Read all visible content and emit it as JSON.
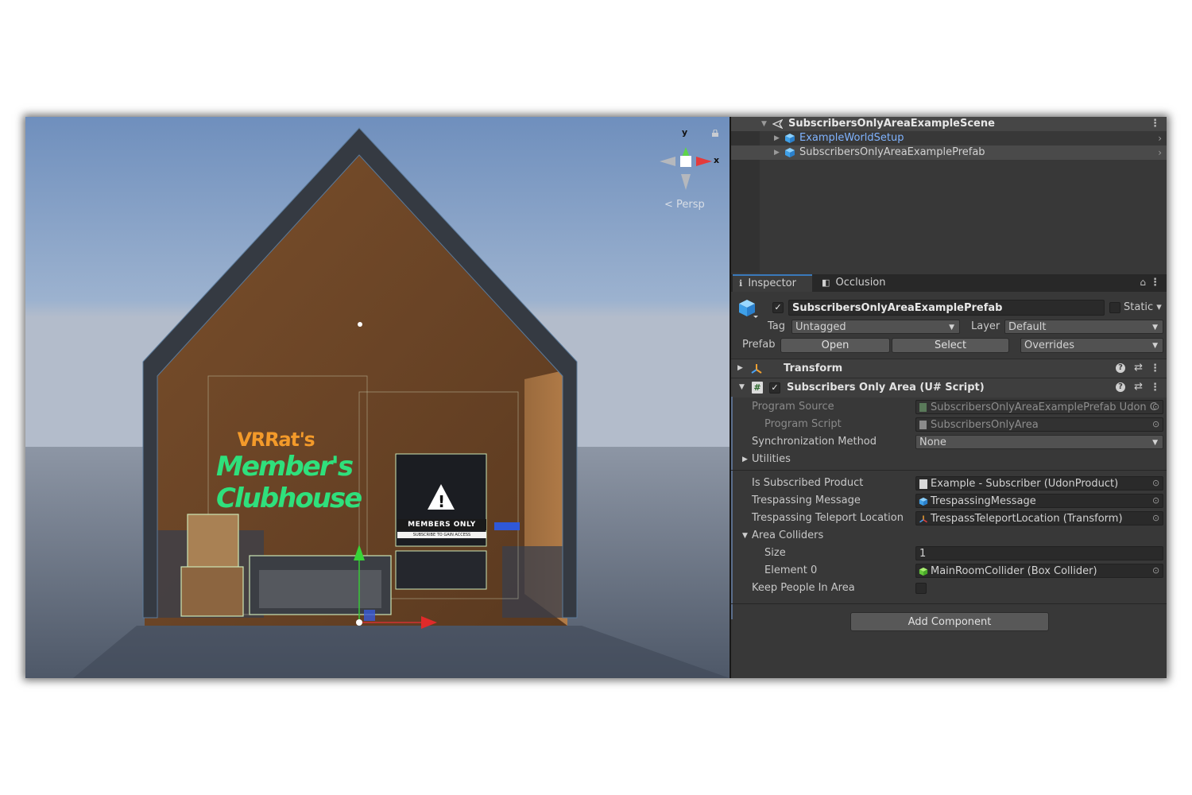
{
  "scene_view": {
    "persp_label": "Persp",
    "axis_y": "y",
    "axis_x": "x",
    "sign": {
      "line1": "VRRat's",
      "line2": "Member's",
      "line3": "Clubhouse"
    },
    "board": {
      "banner": "MEMBERS ONLY",
      "subtitle": "SUBSCRIBE TO GAIN ACCESS"
    },
    "colors": {
      "sky": "#7e9cc4",
      "ground": "#5d6677",
      "wall": "#6b4425",
      "frame": "#353a42",
      "neon_green": "#2fe07c",
      "orange": "#f39a2a"
    }
  },
  "hierarchy": {
    "scene_name": "SubscribersOnlyAreaExampleScene",
    "items": [
      {
        "label": "ExampleWorldSetup",
        "color": "#7fb3ff"
      },
      {
        "label": "SubscribersOnlyAreaExamplePrefab",
        "color": "#d2d2d2"
      }
    ]
  },
  "tabs": {
    "inspector": "Inspector",
    "occlusion": "Occlusion"
  },
  "inspector": {
    "object_name": "SubscribersOnlyAreaExamplePrefab",
    "static_label": "Static",
    "tag_label": "Tag",
    "tag_value": "Untagged",
    "layer_label": "Layer",
    "layer_value": "Default",
    "prefab_label": "Prefab",
    "open_button": "Open",
    "select_button": "Select",
    "overrides_label": "Overrides",
    "transform_title": "Transform",
    "script_title": "Subscribers Only Area (U# Script)",
    "fields": {
      "program_source_label": "Program Source",
      "program_source_value": "SubscribersOnlyAreaExamplePrefab Udon C",
      "program_script_label": "Program Script",
      "program_script_value": "SubscribersOnlyArea",
      "sync_label": "Synchronization Method",
      "sync_value": "None",
      "utilities_label": "Utilities",
      "is_subscribed_label": "Is Subscribed Product",
      "is_subscribed_value": "Example - Subscriber (UdonProduct)",
      "trespass_msg_label": "Trespassing Message",
      "trespass_msg_value": "TrespassingMessage",
      "trespass_tp_label": "Trespassing Teleport Location",
      "trespass_tp_value": "TrespassTeleportLocation (Transform)",
      "area_colliders_label": "Area Colliders",
      "size_label": "Size",
      "size_value": "1",
      "element0_label": "Element 0",
      "element0_value": "MainRoomCollider (Box Collider)",
      "keep_people_label": "Keep People In Area"
    },
    "add_component": "Add Component"
  }
}
